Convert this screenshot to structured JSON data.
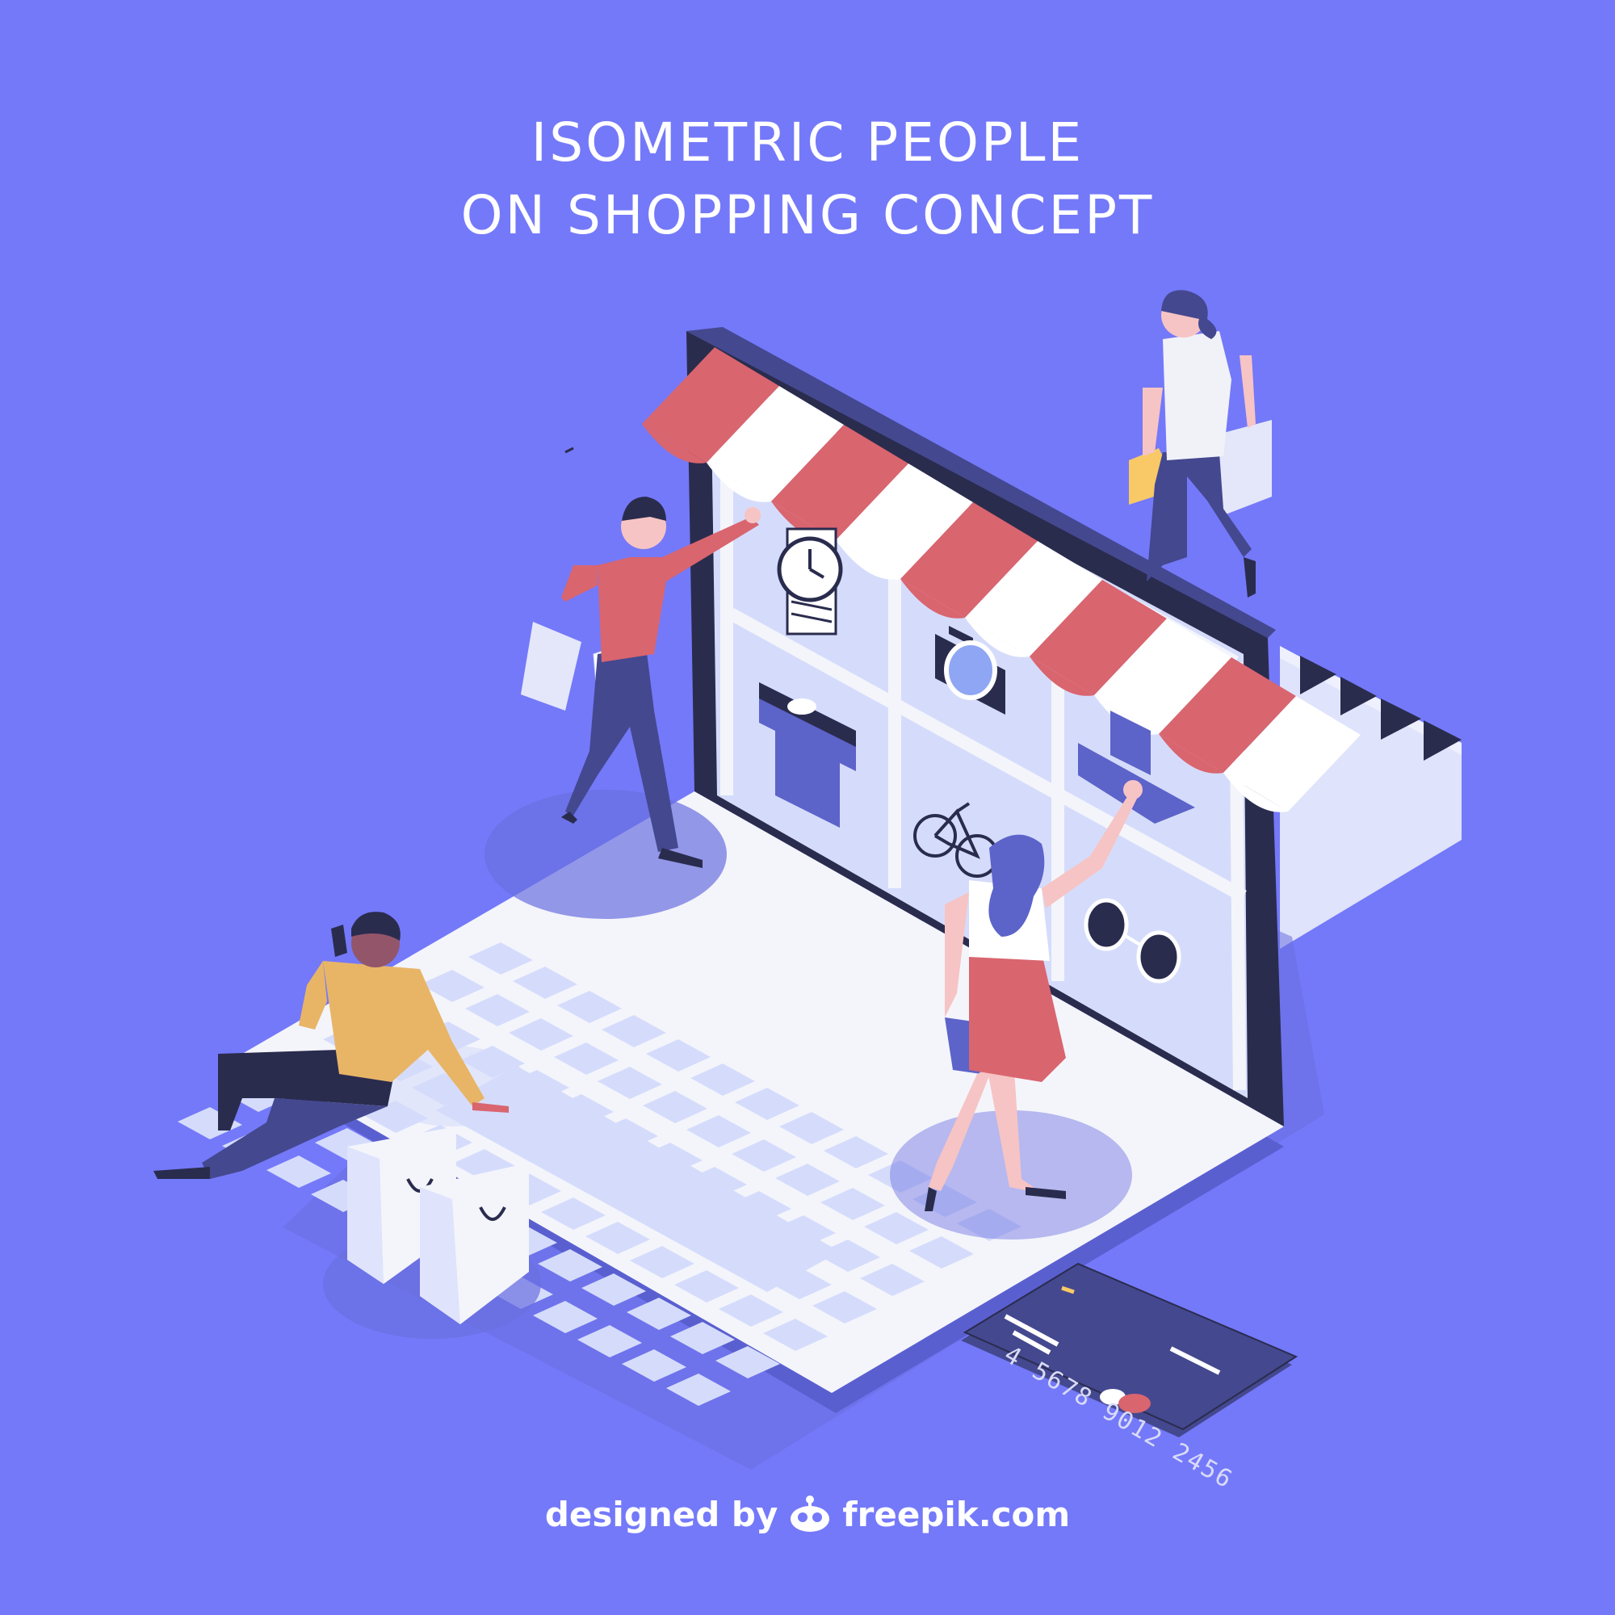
{
  "title": {
    "line1": "ISOMETRIC PEOPLE",
    "line2": "ON SHOPPING CONCEPT"
  },
  "credit_card": {
    "number": "4 5678 9012 2456"
  },
  "footer": {
    "prefix": "designed by",
    "brand": "freepik.com",
    "logo_icon": "freepik-robot-icon"
  },
  "colors": {
    "background": "#7479f9",
    "laptop_frame": "#2a2c4e",
    "laptop_body": "#f4f5fb",
    "screen": "#d5dcfb",
    "awning_red": "#d9656f",
    "shirt_blue": "#5c63c9"
  },
  "icons": [
    "watch-icon",
    "camera-icon",
    "tshirt-icon",
    "hat-icon",
    "bicycle-icon",
    "sunglasses-icon"
  ]
}
